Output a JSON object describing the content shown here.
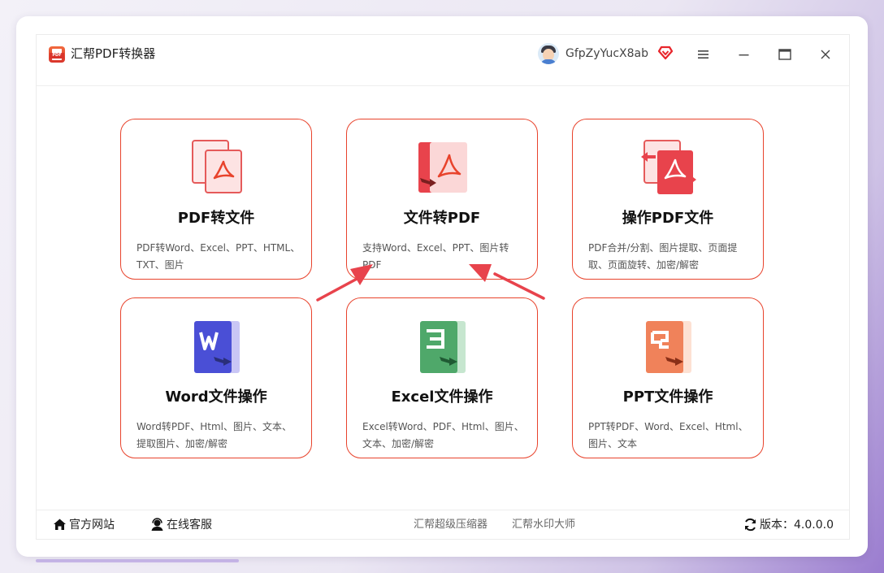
{
  "window": {
    "title": "汇帮PDF转换器",
    "logo_text": "PDF"
  },
  "user": {
    "name": "GfpZyYucX8ab"
  },
  "cards": [
    {
      "title": "PDF转文件",
      "desc": "PDF转Word、Excel、PPT、HTML、TXT、图片"
    },
    {
      "title": "文件转PDF",
      "desc": "支持Word、Excel、PPT、图片转PDF"
    },
    {
      "title": "操作PDF文件",
      "desc": "PDF合并/分割、图片提取、页面提取、页面旋转、加密/解密"
    },
    {
      "title": "Word文件操作",
      "desc": "Word转PDF、Html、图片、文本、提取图片、加密/解密"
    },
    {
      "title": "Excel文件操作",
      "desc": "Excel转Word、PDF、Html、图片、文本、加密/解密"
    },
    {
      "title": "PPT文件操作",
      "desc": "PPT转PDF、Word、Excel、Html、图片、文本"
    }
  ],
  "footer": {
    "official_site": "官方网站",
    "online_service": "在线客服",
    "compressor_link": "汇帮超级压缩器",
    "watermark_link": "汇帮水印大师",
    "version": "版本：4.0.0.0"
  },
  "colors": {
    "accent": "#e8432c",
    "word": "#4a4fd6",
    "excel": "#4fa86a",
    "ppt": "#f0825a",
    "pdf": "#e8432c"
  }
}
